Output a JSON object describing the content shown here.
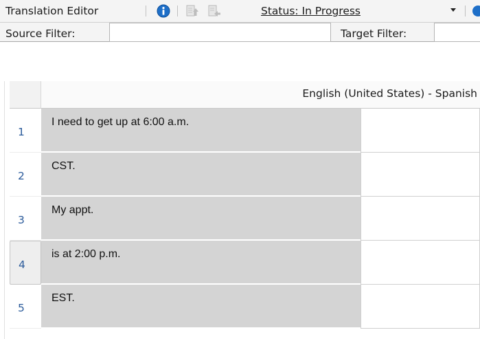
{
  "toolbar": {
    "title": "Translation Editor",
    "status_label": "Status: In Progress",
    "icons": [
      "info-icon",
      "export-icon",
      "import-icon",
      "dropdown-caret-icon"
    ]
  },
  "filters": {
    "source_label": "Source Filter:",
    "source_value": "",
    "target_label": "Target Filter:",
    "target_value": ""
  },
  "grid": {
    "column_header": "English (United States) - Spanish",
    "rows": [
      {
        "num": "1",
        "source": "I need to get up at 6:00 a.m.",
        "target": ""
      },
      {
        "num": "2",
        "source": "CST.",
        "target": ""
      },
      {
        "num": "3",
        "source": "My appt.",
        "target": ""
      },
      {
        "num": "4",
        "source": "is at 2:00 p.m.",
        "target": ""
      },
      {
        "num": "5",
        "source": "EST.",
        "target": ""
      }
    ]
  },
  "colors": {
    "source_cell_bg": "#d4d4d4",
    "row_number": "#2a5a9a",
    "info_icon": "#1e6fc8"
  }
}
